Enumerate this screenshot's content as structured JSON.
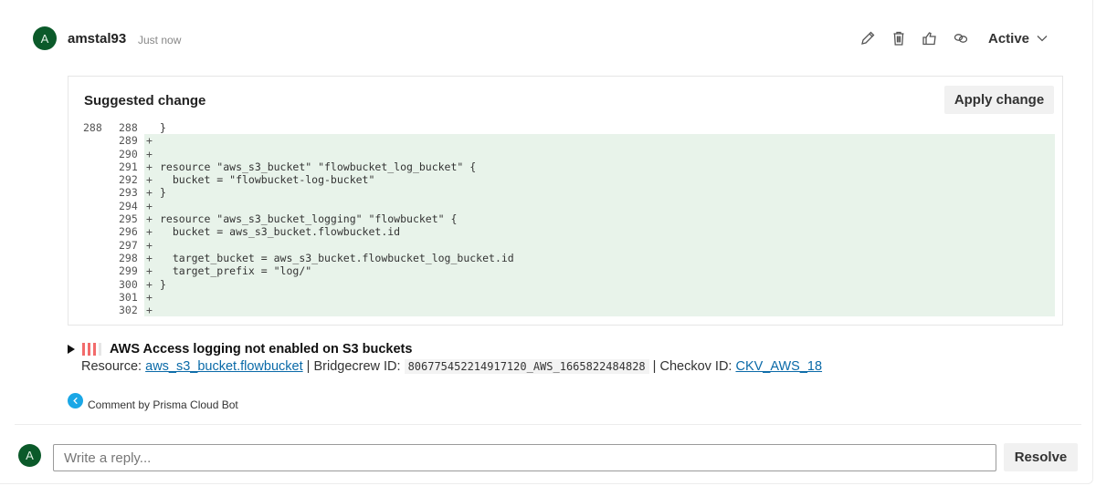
{
  "comment": {
    "avatar_initial": "A",
    "author": "amstal93",
    "timestamp": "Just now",
    "status": "Active",
    "actions": [
      {
        "name": "edit",
        "icon": "pencil-icon"
      },
      {
        "name": "delete",
        "icon": "trash-icon"
      },
      {
        "name": "like",
        "icon": "thumbs-up-icon"
      },
      {
        "name": "copy-link",
        "icon": "link-icon"
      }
    ]
  },
  "suggestion": {
    "title": "Suggested change",
    "apply_label": "Apply change",
    "lines": [
      {
        "old": "288",
        "new": "288",
        "sign": "",
        "text": "}",
        "added": false
      },
      {
        "old": "",
        "new": "289",
        "sign": "+",
        "text": "",
        "added": true
      },
      {
        "old": "",
        "new": "290",
        "sign": "+",
        "text": "",
        "added": true
      },
      {
        "old": "",
        "new": "291",
        "sign": "+",
        "text": "resource \"aws_s3_bucket\" \"flowbucket_log_bucket\" {",
        "added": true
      },
      {
        "old": "",
        "new": "292",
        "sign": "+",
        "text": "  bucket = \"flowbucket-log-bucket\"",
        "added": true
      },
      {
        "old": "",
        "new": "293",
        "sign": "+",
        "text": "}",
        "added": true
      },
      {
        "old": "",
        "new": "294",
        "sign": "+",
        "text": "",
        "added": true
      },
      {
        "old": "",
        "new": "295",
        "sign": "+",
        "text": "resource \"aws_s3_bucket_logging\" \"flowbucket\" {",
        "added": true
      },
      {
        "old": "",
        "new": "296",
        "sign": "+",
        "text": "  bucket = aws_s3_bucket.flowbucket.id",
        "added": true
      },
      {
        "old": "",
        "new": "297",
        "sign": "+",
        "text": "",
        "added": true
      },
      {
        "old": "",
        "new": "298",
        "sign": "+",
        "text": "  target_bucket = aws_s3_bucket.flowbucket_log_bucket.id",
        "added": true
      },
      {
        "old": "",
        "new": "299",
        "sign": "+",
        "text": "  target_prefix = \"log/\"",
        "added": true
      },
      {
        "old": "",
        "new": "300",
        "sign": "+",
        "text": "}",
        "added": true
      },
      {
        "old": "",
        "new": "301",
        "sign": "+",
        "text": "",
        "added": true
      },
      {
        "old": "",
        "new": "302",
        "sign": "+",
        "text": "",
        "added": true
      }
    ]
  },
  "finding": {
    "title": "AWS Access logging not enabled on S3 buckets",
    "severity_level": 3,
    "severity_max": 4,
    "severity_color": "#f26b6b",
    "resource_label": "Resource:",
    "resource_link": "aws_s3_bucket.flowbucket",
    "separator": "|",
    "bridgecrew_label": "Bridgecrew ID:",
    "bridgecrew_id": "806775452214917120_AWS_1665822484828",
    "checkov_label": "Checkov ID:",
    "checkov_link": "CKV_AWS_18"
  },
  "bot": {
    "label": "Comment by Prisma Cloud Bot"
  },
  "reply": {
    "avatar_initial": "A",
    "placeholder": "Write a reply...",
    "value": "",
    "resolve_label": "Resolve"
  }
}
